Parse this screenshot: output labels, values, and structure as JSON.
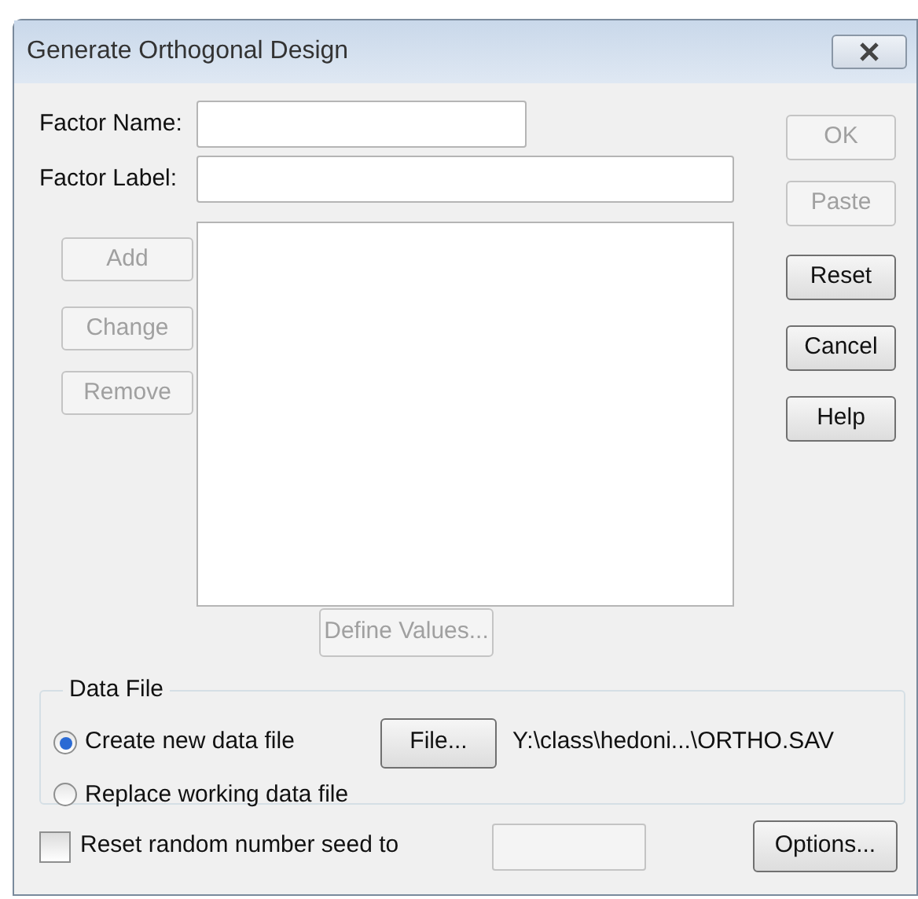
{
  "window": {
    "title": "Generate Orthogonal Design"
  },
  "fields": [
    {
      "label": "Factor Name:"
    },
    {
      "label": "Factor Label:"
    }
  ],
  "side_buttons": [
    {
      "label": "Add",
      "disabled": true
    },
    {
      "label": "Change",
      "disabled": true
    },
    {
      "label": "Remove",
      "disabled": true
    }
  ],
  "define_values": {
    "label": "Define Values...",
    "disabled": true
  },
  "right_buttons": [
    {
      "label": "OK",
      "disabled": true
    },
    {
      "label": "Paste",
      "disabled": true
    },
    {
      "label": "Reset",
      "disabled": false
    },
    {
      "label": "Cancel",
      "disabled": false
    },
    {
      "label": "Help",
      "disabled": false
    }
  ],
  "data_file": {
    "title": "Data File",
    "options": [
      {
        "label": "Create new data file",
        "selected": true
      },
      {
        "label": "Replace working data file",
        "selected": false
      }
    ],
    "file_button": "File...",
    "path": "Y:\\class\\hedoni...\\ORTHO.SAV"
  },
  "seed": {
    "label": "Reset random number seed to",
    "checked": false
  },
  "options_button": "Options..."
}
